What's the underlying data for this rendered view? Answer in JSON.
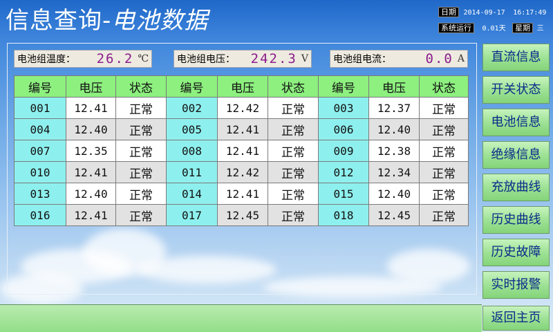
{
  "header": {
    "title_main": "信息查询-",
    "title_sub": "电池数据",
    "date_label": "日期",
    "date_value": "2014-09-17",
    "time_value": "16:17:49",
    "runtime_label": "系统运行",
    "runtime_value": "0.01天",
    "weekday_label": "星期",
    "weekday_value": "三"
  },
  "readouts": {
    "temperature": {
      "label": "电池组温度：",
      "value": "26.2",
      "unit": "℃"
    },
    "voltage": {
      "label": "电池组电压：",
      "value": "242.3",
      "unit": "V"
    },
    "current": {
      "label": "电池组电流：",
      "value": "0.0",
      "unit": "A"
    }
  },
  "table": {
    "headers": [
      "编号",
      "电压",
      "状态",
      "编号",
      "电压",
      "状态",
      "编号",
      "电压",
      "状态"
    ],
    "rows": [
      [
        [
          "001",
          "12.41",
          "正常"
        ],
        [
          "002",
          "12.42",
          "正常"
        ],
        [
          "003",
          "12.37",
          "正常"
        ]
      ],
      [
        [
          "004",
          "12.40",
          "正常"
        ],
        [
          "005",
          "12.41",
          "正常"
        ],
        [
          "006",
          "12.40",
          "正常"
        ]
      ],
      [
        [
          "007",
          "12.35",
          "正常"
        ],
        [
          "008",
          "12.41",
          "正常"
        ],
        [
          "009",
          "12.38",
          "正常"
        ]
      ],
      [
        [
          "010",
          "12.41",
          "正常"
        ],
        [
          "011",
          "12.42",
          "正常"
        ],
        [
          "012",
          "12.34",
          "正常"
        ]
      ],
      [
        [
          "013",
          "12.40",
          "正常"
        ],
        [
          "014",
          "12.41",
          "正常"
        ],
        [
          "015",
          "12.40",
          "正常"
        ]
      ],
      [
        [
          "016",
          "12.41",
          "正常"
        ],
        [
          "017",
          "12.45",
          "正常"
        ],
        [
          "018",
          "12.45",
          "正常"
        ]
      ]
    ]
  },
  "menu": [
    "直流信息",
    "开关状态",
    "电池信息",
    "绝缘信息",
    "充放曲线",
    "历史曲线",
    "历史故障",
    "实时报警",
    "返回主页"
  ],
  "colors": {
    "header_bg": "#8df07f",
    "id_cell_bg": "#8ef0ee",
    "value_text": "#8b1c8b",
    "menu_text": "#0a2a8a"
  }
}
